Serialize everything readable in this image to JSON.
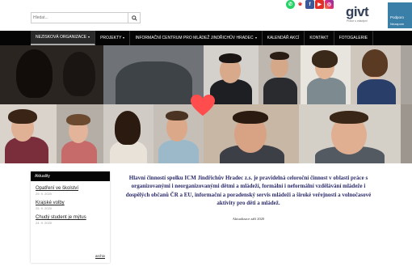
{
  "header": {
    "search": {
      "placeholder": "Hledat...",
      "value": ""
    },
    "social_icons": [
      "whatsapp-icon",
      "ecard-icon",
      "facebook-icon",
      "youtube-icon",
      "instagram-icon"
    ],
    "logo": {
      "name": "givt",
      "tagline": "Práce s mladými"
    },
    "side_banner": {
      "line1": "Podporo",
      "line2": "Nezapom"
    }
  },
  "nav": {
    "items": [
      {
        "label": "Nezisková organizace",
        "dropdown": true,
        "active": true
      },
      {
        "label": "Projekty",
        "dropdown": true,
        "active": false
      },
      {
        "label": "Informační centrum pro mládež Jindřichův Hradec",
        "dropdown": true,
        "active": false
      },
      {
        "label": "Kalendář akcí",
        "dropdown": false,
        "active": false
      },
      {
        "label": "Kontakt",
        "dropdown": false,
        "active": false
      },
      {
        "label": "Fotogalerie",
        "dropdown": false,
        "active": false
      }
    ]
  },
  "sidebar": {
    "title": "Aktuality",
    "news": [
      {
        "title": "Opatření ve školství",
        "date": "29. 9. 2020"
      },
      {
        "title": "Krajské volby",
        "date": "25. 9. 2020"
      },
      {
        "title": "Chudý student je mýtus",
        "date": "24. 9. 2020"
      }
    ],
    "archive_label": "archiv"
  },
  "main": {
    "paragraph": "Hlavní činností spolku ICM Jindřichův Hradec z.s. je pravidelná celoroční činnost v oblasti práce s organizovanými i neorganizovanými dětmi a mládeží, formální i neformální vzdělávání mládeže i dospělých občanů ČR a EU, informační a poradenský servis mládeži a široké veřejnosti a volnočasové aktivity pro děti a mládež.",
    "updated": "Aktualizace září 2020"
  },
  "colors": {
    "nav_bg": "#050505",
    "text_blue": "#2a2a6a",
    "heart": "#ff4d4d"
  }
}
